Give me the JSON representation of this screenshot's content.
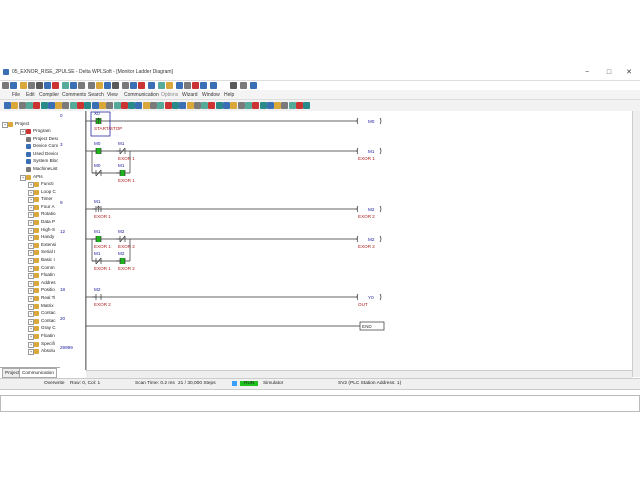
{
  "window": {
    "title": "05_EXNOR_RISE_2PULSE - Delta WPLSoft - [Monitor Ladder Diagram]",
    "buttons": {
      "minimize": "−",
      "maximize": "□",
      "close": "✕"
    }
  },
  "menu": {
    "items": [
      "File",
      "Edit",
      "Compiler",
      "Comments",
      "Search",
      "View",
      "Communication",
      "Options",
      "Wizard",
      "Window",
      "Help"
    ]
  },
  "tree": {
    "root": "Project",
    "nodes": [
      "Program",
      "Project Desc",
      "Device Comm",
      "Used Device",
      "System Bloc",
      "MachineList",
      "APIs"
    ],
    "api_nodes": [
      "Functi",
      "Loop C",
      "Timer",
      "Four A",
      "Rotatio",
      "Data P",
      "High-S",
      "Handy",
      "Extensi",
      "Serial I",
      "Basic I",
      "Comm",
      "Floatin",
      "Addres",
      "Positio",
      "Real Ti",
      "Matrix",
      "Contac",
      "Contac",
      "Gray C",
      "Floatin",
      "Specifi",
      "Absolu"
    ],
    "tabs": [
      "Project",
      "Communication"
    ]
  },
  "steps": [
    "0",
    "3",
    "9",
    "12",
    "18",
    "20",
    "29999"
  ],
  "ladder": {
    "rungs": [
      {
        "contacts": [
          {
            "dev": "X0",
            "com": "START/STOP",
            "type": "rise",
            "on": true
          }
        ],
        "coil": {
          "dev": "M0",
          "com": ""
        }
      },
      {
        "contacts": [
          {
            "dev": "M0",
            "com": "",
            "type": "no",
            "on": true
          },
          {
            "dev": "M1",
            "com": "EXOR 1",
            "type": "nc",
            "on": false
          }
        ],
        "branch": [
          {
            "dev": "M0",
            "com": "",
            "type": "nc",
            "on": false
          },
          {
            "dev": "M1",
            "com": "EXOR 1",
            "type": "no",
            "on": true
          }
        ],
        "coil": {
          "dev": "M1",
          "com": "EXOR 1"
        }
      },
      {
        "contacts": [
          {
            "dev": "M1",
            "com": "EXOR 1",
            "type": "rise",
            "on": false
          }
        ],
        "coil": {
          "dev": "M2",
          "com": "EXOR 2"
        }
      },
      {
        "contacts": [
          {
            "dev": "M1",
            "com": "EXOR 1",
            "type": "no",
            "on": true
          },
          {
            "dev": "M2",
            "com": "EXOR 2",
            "type": "nc",
            "on": false
          }
        ],
        "branch": [
          {
            "dev": "M1",
            "com": "EXOR 1",
            "type": "nc",
            "on": false
          },
          {
            "dev": "M2",
            "com": "EXOR 2",
            "type": "no",
            "on": true
          }
        ],
        "coil": {
          "dev": "M2",
          "com": "EXOR 2"
        }
      },
      {
        "contacts": [
          {
            "dev": "M2",
            "com": "EXOR 2",
            "type": "no",
            "on": false
          }
        ],
        "coil": {
          "dev": "Y0",
          "com": "OUT"
        }
      }
    ],
    "end_label": "END"
  },
  "status": {
    "mode": "Overwrite",
    "position": "Row: 0, Col: 1",
    "scan_time": "Scan Time: 0.2 ms",
    "steps": "21 / 30,000 Steps",
    "run": "RUN",
    "simulator": "Simulator",
    "station": "SV2 (PLC Station Address: 1)"
  },
  "colors": {
    "contact_on": "#20b020",
    "device_text": "#1a1a9a",
    "comment_text": "#b02020",
    "rail": "#333333"
  }
}
